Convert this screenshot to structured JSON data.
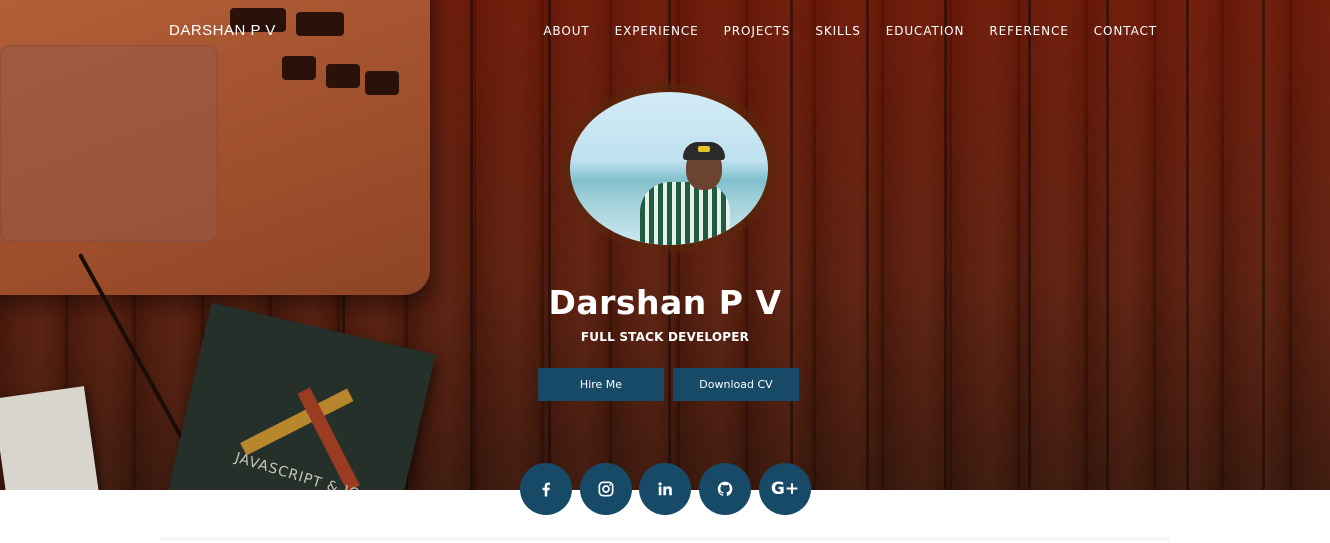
{
  "brand": "DARSHAN P V",
  "nav": {
    "items": [
      "ABOUT",
      "EXPERIENCE",
      "PROJECTS",
      "SKILLS",
      "EDUCATION",
      "REFERENCE",
      "CONTACT"
    ]
  },
  "profile": {
    "name": "Darshan P V",
    "role": "FULL STACK DEVELOPER",
    "hire_label": "Hire Me",
    "cv_label": "Download CV"
  },
  "background": {
    "book_title": "JAVASCRIPT & JQ"
  },
  "socials": {
    "facebook": "facebook-icon",
    "instagram": "instagram-icon",
    "linkedin": "linkedin-icon",
    "github": "github-icon",
    "googleplus": "google-plus-icon",
    "gplus_text": "G+"
  },
  "colors": {
    "accent": "#174a67",
    "hero_tint": "#6e0e00"
  }
}
